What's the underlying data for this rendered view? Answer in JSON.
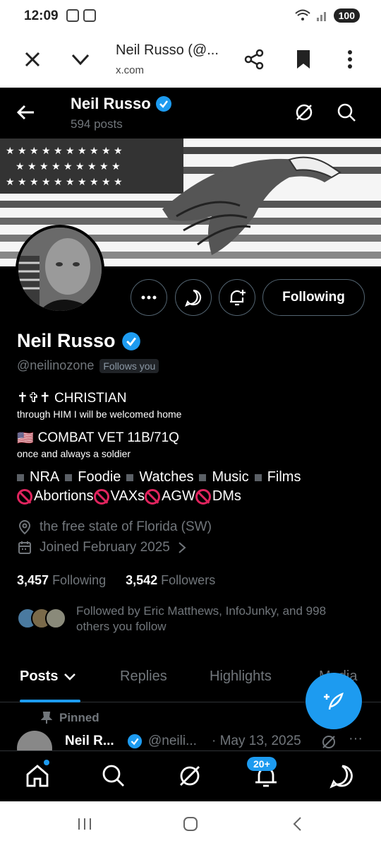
{
  "status_bar": {
    "time": "12:09",
    "battery": "100"
  },
  "browser": {
    "title": "Neil Russo (@...",
    "url": "x.com"
  },
  "header": {
    "name": "Neil Russo",
    "posts_count": "594 posts"
  },
  "profile": {
    "name": "Neil Russo",
    "handle": "@neilinozone",
    "follows_you": "Follows you",
    "following_button": "Following",
    "bio_line1": "✝✞✝ CHRISTIAN",
    "bio_line2": "through HIM I will be welcomed home",
    "bio_line3_flag": "🇺🇸",
    "bio_line3": "COMBAT VET 11B/71Q",
    "bio_line4": "once and always a soldier",
    "interests": [
      "NRA",
      "Foodie",
      "Watches",
      "Music",
      "Films"
    ],
    "opposed": [
      "Abortions",
      "VAXs",
      "AGW",
      "DMs"
    ],
    "location": "the free state of Florida (SW)",
    "joined": "Joined February 2025",
    "following_count": "3,457",
    "following_label": "Following",
    "followers_count": "3,542",
    "followers_label": "Followers",
    "followed_by_line1": "Followed by Eric Matthews, InfoJunky, and 998",
    "followed_by_line2": "others you follow"
  },
  "tabs": [
    "Posts",
    "Replies",
    "Highlights",
    "Media"
  ],
  "pinned_post": {
    "pinned_label": "Pinned",
    "name": "Neil R...",
    "handle": "@neili...",
    "date": "· May 13, 2025",
    "more": "···"
  },
  "bottom_nav": {
    "notification_badge": "20+"
  },
  "colors": {
    "accent": "#1d9bf0",
    "background": "#000000",
    "muted": "#71767b"
  }
}
